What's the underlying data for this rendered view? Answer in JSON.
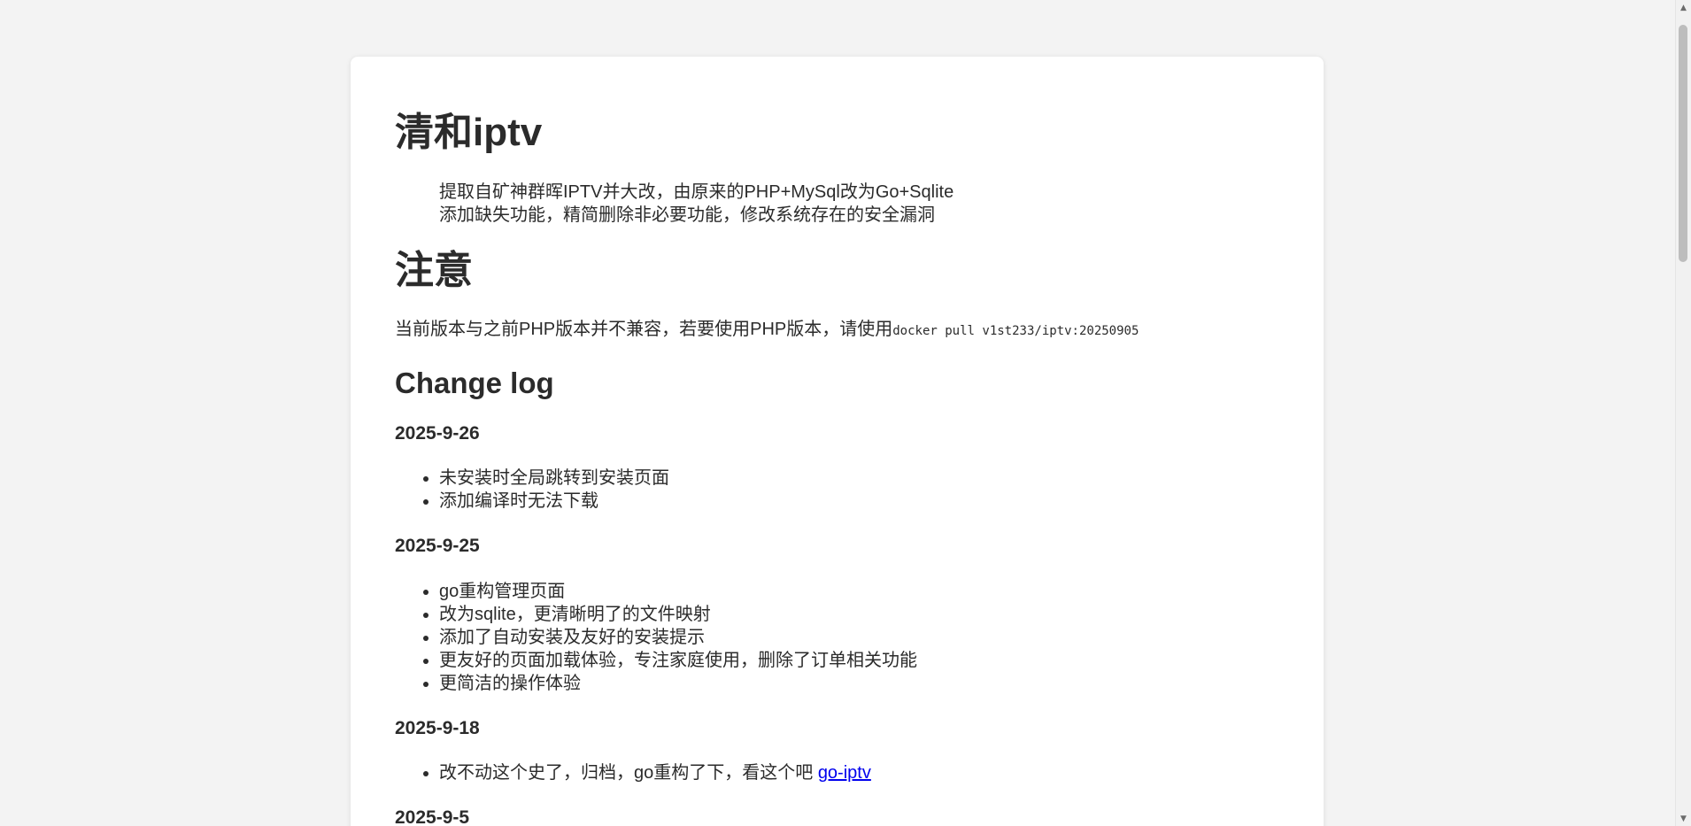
{
  "page": {
    "title": "清和iptv",
    "intro_lines": [
      "提取自矿神群晖IPTV并大改，由原来的PHP+MySql改为Go+Sqlite",
      "添加缺失功能，精简删除非必要功能，修改系统存在的安全漏洞"
    ],
    "notice_heading": "注意",
    "notice_text": "当前版本与之前PHP版本并不兼容，若要使用PHP版本，请使用",
    "notice_code": "docker pull v1st233/iptv:20250905",
    "changelog_heading": "Change log",
    "changelog": [
      {
        "date": "2025-9-26",
        "items": [
          "未安装时全局跳转到安装页面",
          "添加编译时无法下载"
        ]
      },
      {
        "date": "2025-9-25",
        "items": [
          "go重构管理页面",
          "改为sqlite，更清晰明了的文件映射",
          "添加了自动安装及友好的安装提示",
          "更友好的页面加载体验，专注家庭使用，删除了订单相关功能",
          "更简洁的操作体验"
        ]
      },
      {
        "date": "2025-9-18",
        "item_text": "改不动这个史了，归档，go重构了下，看这个吧 ",
        "item_link": "go-iptv"
      },
      {
        "date": "2025-9-5"
      }
    ]
  },
  "scrollbar": {
    "up_icon": "▲",
    "down_icon": "▼",
    "scroll_fraction": 0.0
  }
}
